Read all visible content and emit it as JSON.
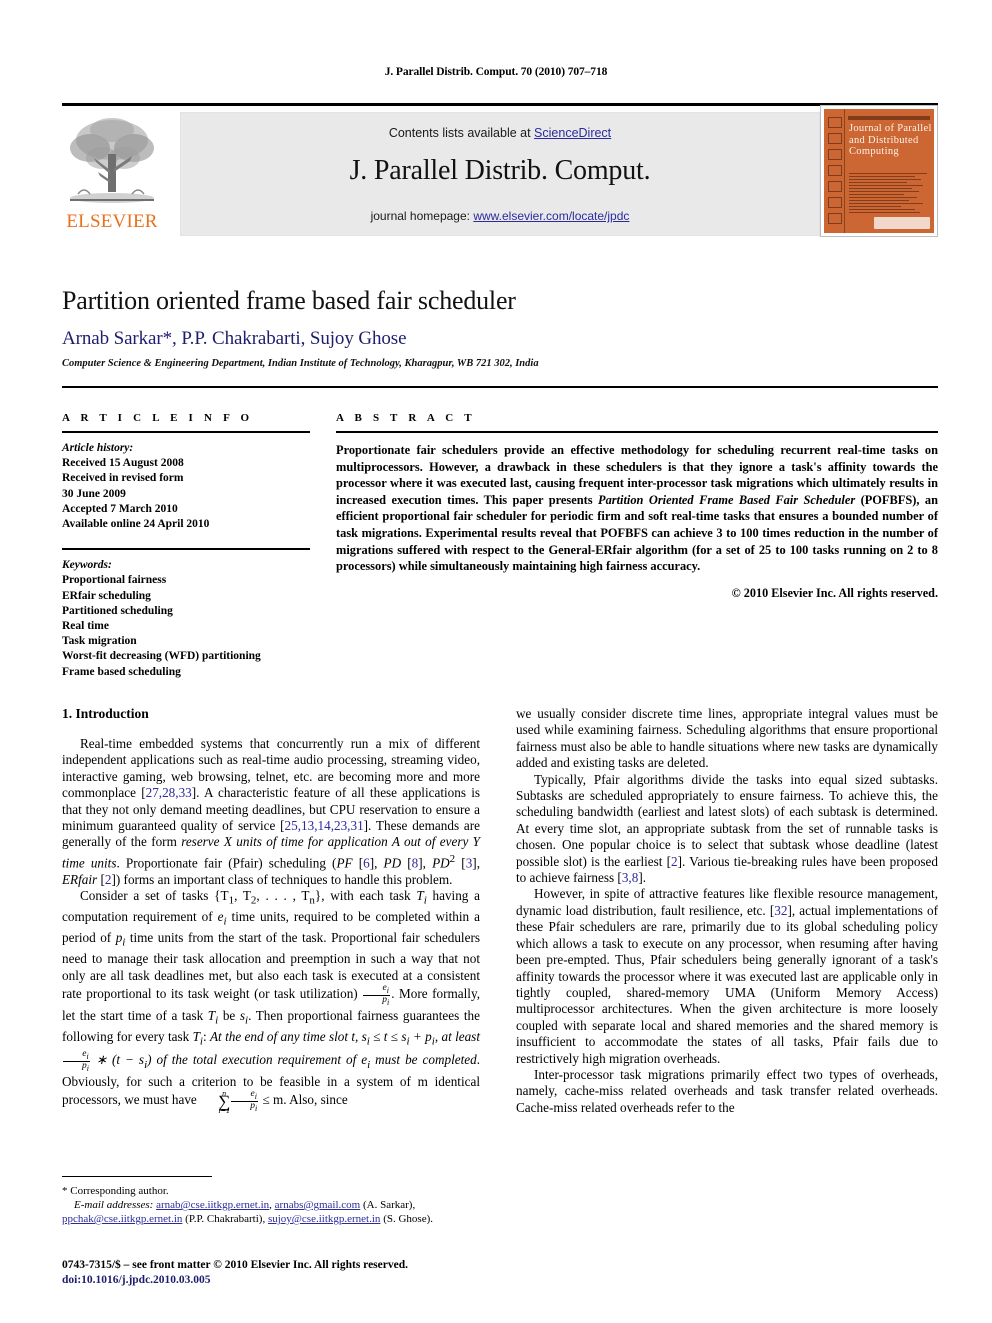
{
  "running_head": "J. Parallel Distrib. Comput. 70 (2010) 707–718",
  "masthead": {
    "publisher_name": "ELSEVIER",
    "contents_prefix": "Contents lists available at ",
    "contents_link": "ScienceDirect",
    "journal_name": "J. Parallel Distrib. Comput.",
    "homepage_prefix": "journal homepage: ",
    "homepage_url": "www.elsevier.com/locate/jpdc",
    "cover_title": "Journal of Parallel and Distributed Computing",
    "cover_color": "#CC6633",
    "link_color": "#2b2b9e",
    "brand_color": "#E8721C"
  },
  "article": {
    "title": "Partition oriented frame based fair scheduler",
    "authors": "Arnab Sarkar*, P.P. Chakrabarti, Sujoy Ghose",
    "affiliation": "Computer Science & Engineering Department, Indian Institute of Technology, Kharagpur, WB 721 302, India"
  },
  "info": {
    "heading": "A R T I C L E   I N F O",
    "history_label": "Article history:",
    "history": [
      "Received 15 August 2008",
      "Received in revised form",
      "30 June 2009",
      "Accepted 7 March 2010",
      "Available online 24 April 2010"
    ],
    "keywords_label": "Keywords:",
    "keywords": [
      "Proportional fairness",
      "ERfair scheduling",
      "Partitioned scheduling",
      "Real time",
      "Task migration",
      "Worst-fit decreasing (WFD) partitioning",
      "Frame based scheduling"
    ]
  },
  "abstract": {
    "heading": "A B S T R A C T",
    "part1": "Proportionate fair schedulers provide an effective methodology for scheduling recurrent real-time tasks on multiprocessors. However, a drawback in these schedulers is that they ignore a task's affinity towards the processor where it was executed last, causing frequent inter-processor task migrations which ultimately results in increased execution times. This paper presents ",
    "italic1": "Partition Oriented Frame Based Fair Scheduler",
    "part2": " (POFBFS), an efficient proportional fair scheduler for periodic firm and soft real-time tasks that ensures a bounded number of task migrations. Experimental results reveal that POFBFS can achieve 3 to 100 times reduction in the number of migrations suffered with respect to the General-ERfair algorithm (for a set of 25 to 100 tasks running on 2 to 8 processors) while simultaneously maintaining high fairness accuracy.",
    "copyright": "© 2010 Elsevier Inc. All rights reserved."
  },
  "body": {
    "section_heading": "1. Introduction",
    "left": {
      "p1_a": "Real-time embedded systems that concurrently run a mix of different independent applications such as real-time audio processing, streaming video, interactive gaming, web browsing, telnet, etc. are becoming more and more commonplace [",
      "p1_ref1": "27,28,33",
      "p1_b": "]. A characteristic feature of all these applications is that they not only demand meeting deadlines, but CPU reservation to ensure a minimum guaranteed quality of service [",
      "p1_ref2": "25,13,14,23,31",
      "p1_c": "]. These demands are generally of the form ",
      "p1_it1": "reserve X units of time for application A out of every Y time units",
      "p1_d": ". Proportionate fair (Pfair) scheduling (",
      "p1_it2": "PF",
      "p1_e": " [",
      "p1_ref3": "6",
      "p1_f": "], ",
      "p1_it3": "PD",
      "p1_g": " [",
      "p1_ref4": "8",
      "p1_h": "], ",
      "p1_it4": "PD",
      "p1_sup": "2",
      "p1_i": " [",
      "p1_ref5": "3",
      "p1_j": "], ",
      "p1_it5": "ERfair",
      "p1_k": " [",
      "p1_ref6": "2",
      "p1_l": "]) forms an important class of techniques to handle this problem.",
      "p2_a": "Consider a set of tasks {T",
      "p2_sub1": "1",
      "p2_b": ", T",
      "p2_sub2": "2",
      "p2_c": ", . . . , T",
      "p2_sub3": "n",
      "p2_d": "}, with each task ",
      "p2_ti": "T",
      "p2_ti_sub": "i",
      "p2_e": " having a computation requirement of ",
      "p2_ei": "e",
      "p2_ei_sub": "i",
      "p2_f": " time units, required to be completed within a period of ",
      "p2_pi": "p",
      "p2_pi_sub": "i",
      "p2_g": " time units from the start of the task. Proportional fair schedulers need to manage their task allocation and preemption in such a way that not only are all task deadlines met, but also each task is executed at a consistent rate proportional to its task weight (or task utilization) ",
      "p2_frac_num": "e",
      "p2_frac_num_sub": "i",
      "p2_frac_den": "p",
      "p2_frac_den_sub": "i",
      "p2_h": ". More formally, let the start time of a task ",
      "p2_i": " be ",
      "p2_si": "s",
      "p2_si_sub": "i",
      "p2_j": ". Then proportional fairness guarantees the following for every task ",
      "p2_k": ": ",
      "p2_it_a": "At the end of any time slot t, s",
      "p2_it_a_sub": "i",
      "p2_it_b": " ≤ t ≤ s",
      "p2_it_b_sub": "i",
      "p2_it_c": " + p",
      "p2_it_c_sub": "i",
      "p2_it_d": ", at least ",
      "p2_it_e": " ∗ (t − s",
      "p2_it_e_sub": "i",
      "p2_it_f": ") of the total execution requirement of e",
      "p2_it_f_sub": "i",
      "p2_it_g": " must be completed",
      "p2_l": ". Obviously, for such a criterion to be feasible in a system of m identical processors, we must have ",
      "p2_sum_top": "n",
      "p2_sum_bot": "i=1",
      "p2_m": " ≤ m. Also, since"
    },
    "right": {
      "p3": "we usually consider discrete time lines, appropriate integral values must be used while examining fairness. Scheduling algorithms that ensure proportional fairness must also be able to handle situations where new tasks are dynamically added and existing tasks are deleted.",
      "p4_a": "Typically, Pfair algorithms divide the tasks into equal sized subtasks. Subtasks are scheduled appropriately to ensure fairness. To achieve this, the scheduling bandwidth (earliest and latest slots) of each subtask is determined. At every time slot, an appropriate subtask from the set of runnable tasks is chosen. One popular choice is to select that subtask whose deadline (latest possible slot) is the earliest [",
      "p4_ref1": "2",
      "p4_b": "]. Various tie-breaking rules have been proposed to achieve fairness [",
      "p4_ref2": "3,8",
      "p4_c": "].",
      "p5_a": "However, in spite of attractive features like flexible resource management, dynamic load distribution, fault resilience, etc. [",
      "p5_ref1": "32",
      "p5_b": "], actual implementations of these Pfair schedulers are rare, primarily due to its global scheduling policy which allows a task to execute on any processor, when resuming after having been pre-empted. Thus, Pfair schedulers being generally ignorant of a task's affinity towards the processor where it was executed last are applicable only in tightly coupled, shared-memory UMA (Uniform Memory Access) multiprocessor architectures. When the given architecture is more loosely coupled with separate local and shared memories and the shared memory is insufficient to accommodate the states of all tasks, Pfair fails due to restrictively high migration overheads.",
      "p6": "Inter-processor task migrations primarily effect two types of overheads, namely, cache-miss related overheads and task transfer related overheads. Cache-miss related overheads refer to the"
    }
  },
  "footnote": {
    "corresponding": "* Corresponding author.",
    "email_label": "E-mail addresses:",
    "email1": "arnab@cse.iitkgp.ernet.in",
    "email2": "arnabs@gmail.com",
    "email1_owner": "(A. Sarkar),",
    "email3": "ppchak@cse.iitkgp.ernet.in",
    "email3_owner": "(P.P. Chakrabarti),",
    "email4": "sujoy@cse.iitkgp.ernet.in",
    "email4_owner": "(S. Ghose)."
  },
  "imprint": {
    "issn_line": "0743-7315/$ – see front matter © 2010 Elsevier Inc. All rights reserved.",
    "doi_line": "doi:10.1016/j.jpdc.2010.03.005"
  }
}
